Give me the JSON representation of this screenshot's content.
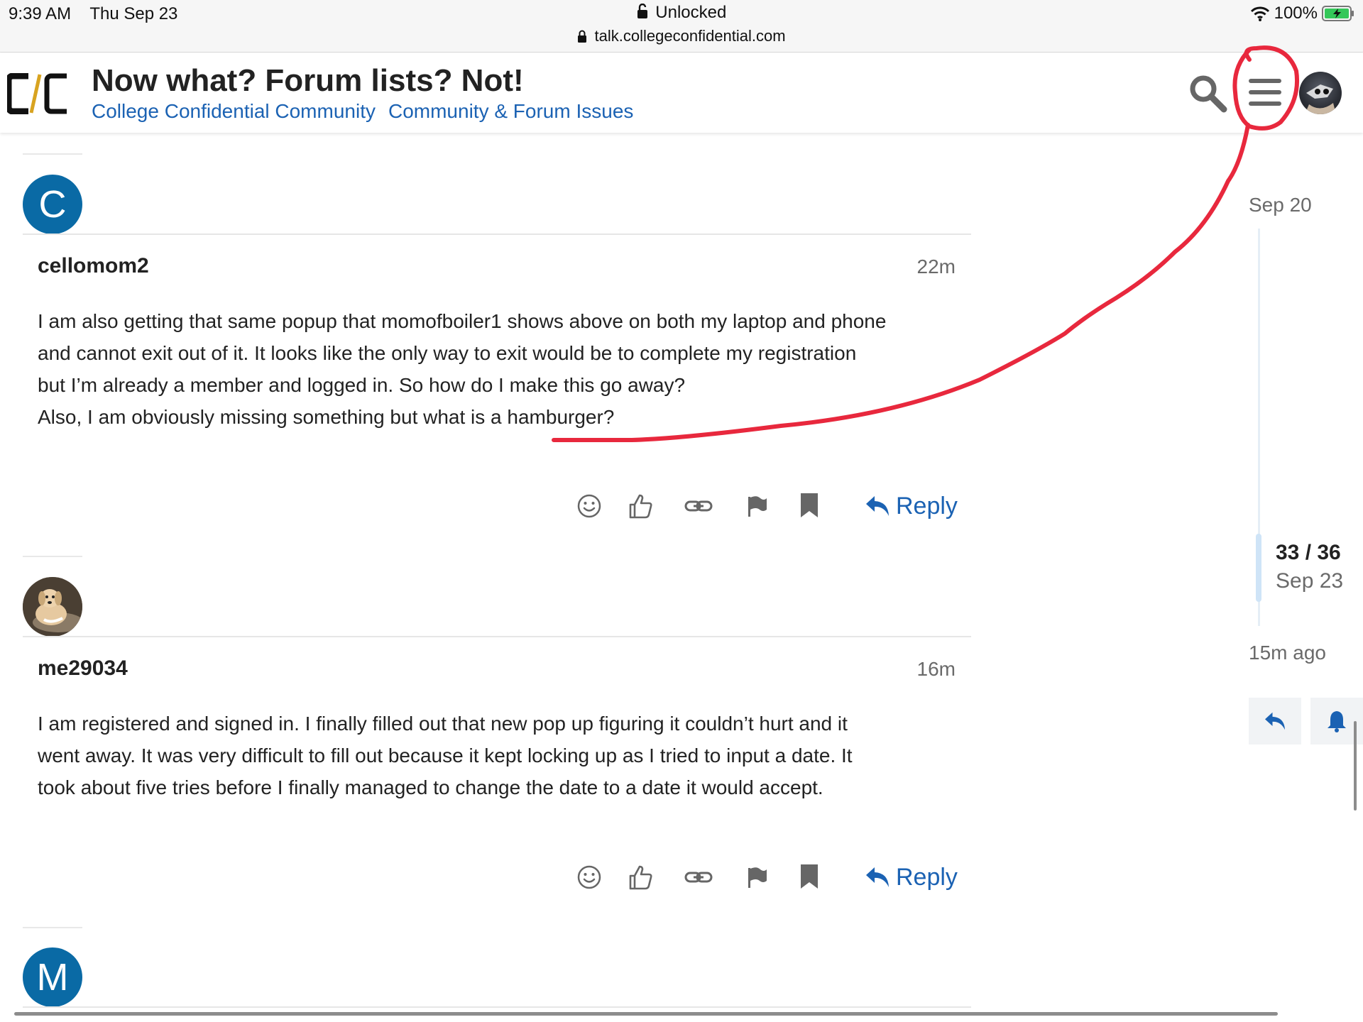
{
  "status_bar": {
    "time": "9:39 AM",
    "date": "Thu Sep 23",
    "lock_status": "Unlocked",
    "url": "talk.collegeconfidential.com",
    "battery": "100%"
  },
  "header": {
    "title": "Now what? Forum lists? Not!",
    "breadcrumbs": [
      "College Confidential Community",
      "Community & Forum Issues"
    ]
  },
  "posts": [
    {
      "avatar_letter": "C",
      "username": "cellomom2",
      "time": "22m",
      "lines": [
        "I am also getting that same popup that momofboiler1 shows above on both my laptop and phone",
        "and cannot exit out of it. It looks like the only way to exit would be to complete my registration",
        "but I’m already a member and logged in. So how do I make this go away?",
        "Also, I am obviously missing something but what is a hamburger?"
      ],
      "reply_label": "Reply"
    },
    {
      "username": "me29034",
      "time": "16m",
      "lines": [
        "I am registered and signed in. I finally filled out that new pop up figuring it couldn’t hurt and it",
        "went away. It was very difficult to fill out because it kept locking up as I tried to input a date. It",
        "took about five tries before I finally managed to change the date to a date it would accept."
      ],
      "reply_label": "Reply"
    },
    {
      "avatar_letter": "M"
    }
  ],
  "timeline": {
    "start_date": "Sep 20",
    "position": "33 / 36",
    "current_date": "Sep 23",
    "last_activity": "15m ago"
  },
  "colors": {
    "link": "#1b62b3",
    "avatar_blue": "#0a6aa5",
    "annotation_red": "#e8283d"
  }
}
